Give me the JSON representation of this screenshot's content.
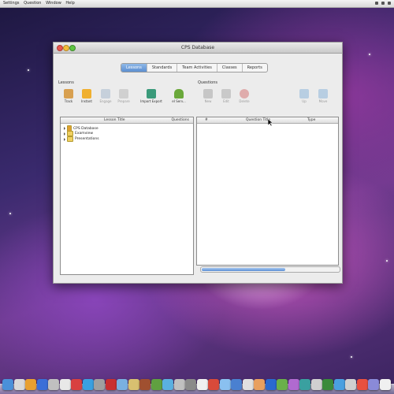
{
  "menubar": {
    "items": [
      "Settings",
      "Question",
      "Window",
      "Help"
    ]
  },
  "window": {
    "title": "CPS Database",
    "tabs": [
      {
        "label": "Lessons",
        "active": true
      },
      {
        "label": "Standards",
        "active": false
      },
      {
        "label": "Team Activities",
        "active": false
      },
      {
        "label": "Classes",
        "active": false
      },
      {
        "label": "Reports",
        "active": false
      }
    ],
    "left_section_label": "Lessons",
    "right_section_label": "Questions",
    "left_tools": [
      {
        "label": "Track",
        "icon": "magnifier-icon",
        "color": "#d8a050",
        "enabled": true
      },
      {
        "label": "Instant",
        "icon": "instant-icon",
        "color": "#f0b030",
        "enabled": true
      },
      {
        "label": "Engage",
        "icon": "engage-icon",
        "color": "#9ab0c8",
        "enabled": false
      },
      {
        "label": "Prepare",
        "icon": "prepare-icon",
        "color": "#b0b0b0",
        "enabled": false
      },
      {
        "label": "Import Export",
        "icon": "import-export-icon",
        "color": "#3a9a7a",
        "enabled": true
      },
      {
        "label": "eI Serv...",
        "icon": "android-icon",
        "color": "#6aa83a",
        "enabled": true
      }
    ],
    "right_tools": [
      {
        "label": "New",
        "icon": "new-question-icon",
        "color": "#9a9a9a",
        "enabled": false
      },
      {
        "label": "Edit",
        "icon": "edit-icon",
        "color": "#a0a0a0",
        "enabled": false
      },
      {
        "label": "Delete",
        "icon": "delete-icon",
        "color": "#d06060",
        "enabled": false
      },
      {
        "label": "Up",
        "icon": "up-arrow-icon",
        "color": "#7aaad8",
        "enabled": false
      },
      {
        "label": "Move",
        "icon": "move-icon",
        "color": "#7aaad8",
        "enabled": false
      }
    ],
    "lessons_table": {
      "columns": [
        "Lesson Title",
        "Questions"
      ],
      "items": [
        {
          "label": "CPS Database",
          "icon": "database-icon"
        },
        {
          "label": "Examview",
          "icon": "folder-icon"
        },
        {
          "label": "Presentations",
          "icon": "folder-icon"
        }
      ]
    },
    "questions_table": {
      "columns": [
        "#",
        "Question Title",
        "Type"
      ]
    }
  },
  "dock": {
    "icon_colors": [
      "#4a90d9",
      "#d9d9d9",
      "#e8a030",
      "#3a6fd8",
      "#c0c0c0",
      "#e8e8e8",
      "#d84040",
      "#3aa0e0",
      "#a0a0a0",
      "#c83030",
      "#7ab0e0",
      "#d8c070",
      "#a05030",
      "#60a040",
      "#5ab0e0",
      "#c0c0c0",
      "#8a8a8a",
      "#f0f0f0",
      "#d84a3a",
      "#8ac0f0",
      "#4a80d0",
      "#e0e0e0",
      "#e8a060",
      "#2a6ad0",
      "#6ab04a",
      "#b06ad0",
      "#3aa0a0",
      "#d0d0d0",
      "#3a8a3a",
      "#4aa0e0",
      "#d0d0d0",
      "#e85040",
      "#8a8ad8",
      "#f0f0f0"
    ]
  }
}
